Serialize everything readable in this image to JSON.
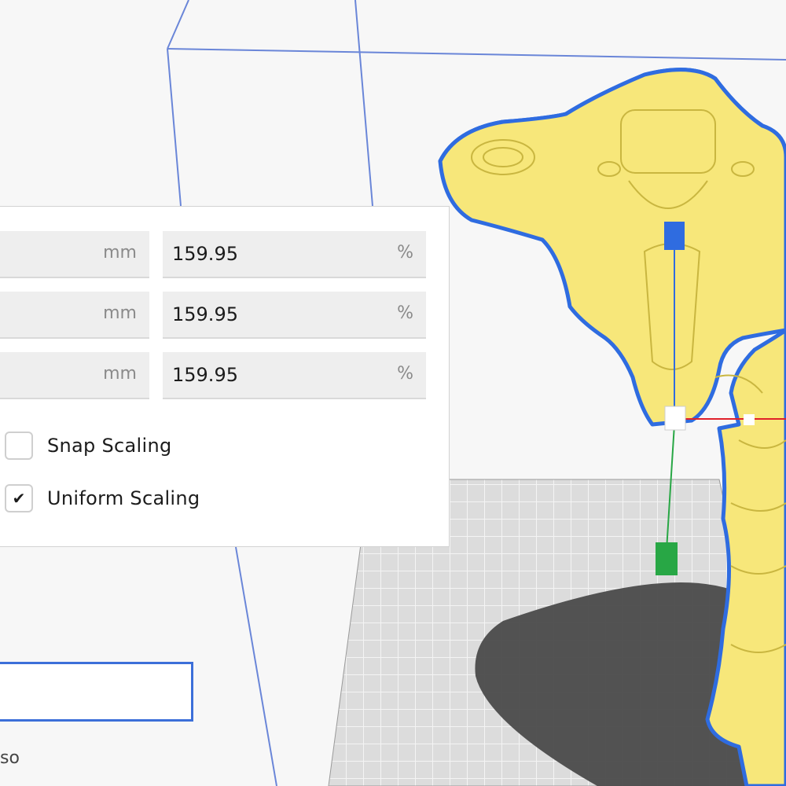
{
  "scale_panel": {
    "rows": [
      {
        "mm_unit": "mm",
        "percent": "159.95",
        "percent_unit": "%"
      },
      {
        "mm_unit": "mm",
        "percent": "159.95",
        "percent_unit": "%"
      },
      {
        "mm_unit": "mm",
        "percent": "159.95",
        "percent_unit": "%"
      }
    ],
    "snap_scaling": {
      "label": "Snap Scaling",
      "checked": false
    },
    "uniform_scaling": {
      "label": "Uniform Scaling",
      "checked": true,
      "mark": "✔"
    }
  },
  "bottom_text": "so",
  "colors": {
    "model_fill": "#f7e77a",
    "model_outline": "#2f6ce0",
    "axis_z": "#2f6ce0",
    "axis_y": "#28a745",
    "axis_x": "#e0202a",
    "build_plate": "#d8d8d8",
    "shadow": "#4b4b4b"
  },
  "icons": [
    "checkmark-icon",
    "scale-handle-icon"
  ]
}
